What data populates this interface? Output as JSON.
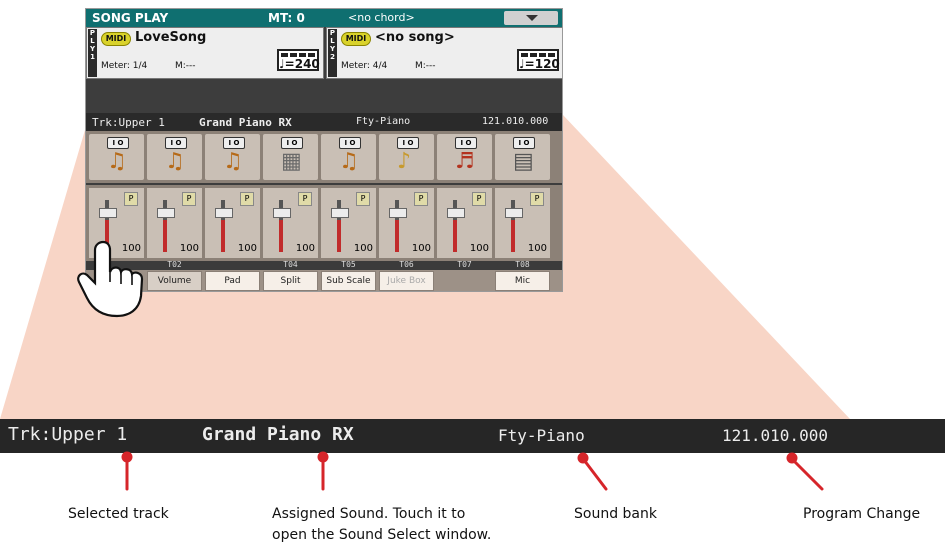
{
  "header": {
    "title": "SONG PLAY",
    "mt": "MT: 0",
    "chord": "<no chord>"
  },
  "players": [
    {
      "tag": "PLY1",
      "midi": "MIDI",
      "song": "LoveSong",
      "meter": "Meter: 1/4",
      "measure": "M:---",
      "tempo": "♩=240"
    },
    {
      "tag": "PLY2",
      "midi": "MIDI",
      "song": "<no song>",
      "meter": "Meter: 4/4",
      "measure": "M:---",
      "tempo": "♩=120"
    }
  ],
  "track_bar": {
    "track": "Trk:Upper 1",
    "sound": "Grand Piano RX",
    "bank": "Fty-Piano",
    "program": "121.010.000"
  },
  "sound_slots": [
    {
      "icon": "acoustic-guitar-icon"
    },
    {
      "icon": "acoustic-guitar-icon"
    },
    {
      "icon": "acoustic-guitar-icon"
    },
    {
      "icon": "drum-kit-icon"
    },
    {
      "icon": "acoustic-guitar-icon"
    },
    {
      "icon": "brass-icon"
    },
    {
      "icon": "strings-icon"
    },
    {
      "icon": "keyboard-icon"
    }
  ],
  "strips": [
    {
      "p": "P",
      "volume": "100",
      "level": 0.85
    },
    {
      "p": "P",
      "volume": "100",
      "level": 0.85
    },
    {
      "p": "P",
      "volume": "100",
      "level": 0.85
    },
    {
      "p": "P",
      "volume": "100",
      "level": 0.85
    },
    {
      "p": "P",
      "volume": "100",
      "level": 0.85
    },
    {
      "p": "P",
      "volume": "100",
      "level": 0.85
    },
    {
      "p": "P",
      "volume": "100",
      "level": 0.85
    },
    {
      "p": "P",
      "volume": "100",
      "level": 0.85
    }
  ],
  "track_numbers": [
    "T02",
    "T04",
    "T05",
    "T06",
    "T07",
    "T08"
  ],
  "tabs": [
    "Volume",
    "Pad",
    "Split",
    "Sub Scale",
    "Juke Box",
    "Mic"
  ],
  "zoom": {
    "track": "Trk:Upper 1",
    "sound": "Grand Piano RX",
    "bank": "Fty-Piano",
    "program": "121.010.000"
  },
  "captions": {
    "track": "Selected track",
    "sound_line1": "Assigned Sound. Touch it to",
    "sound_line2": "open the Sound Select window.",
    "bank": "Sound bank",
    "program": "Program Change"
  },
  "colors": {
    "header_bg": "#0f6f70",
    "pointer": "#d6252a",
    "cone": "#f8d5c6"
  }
}
